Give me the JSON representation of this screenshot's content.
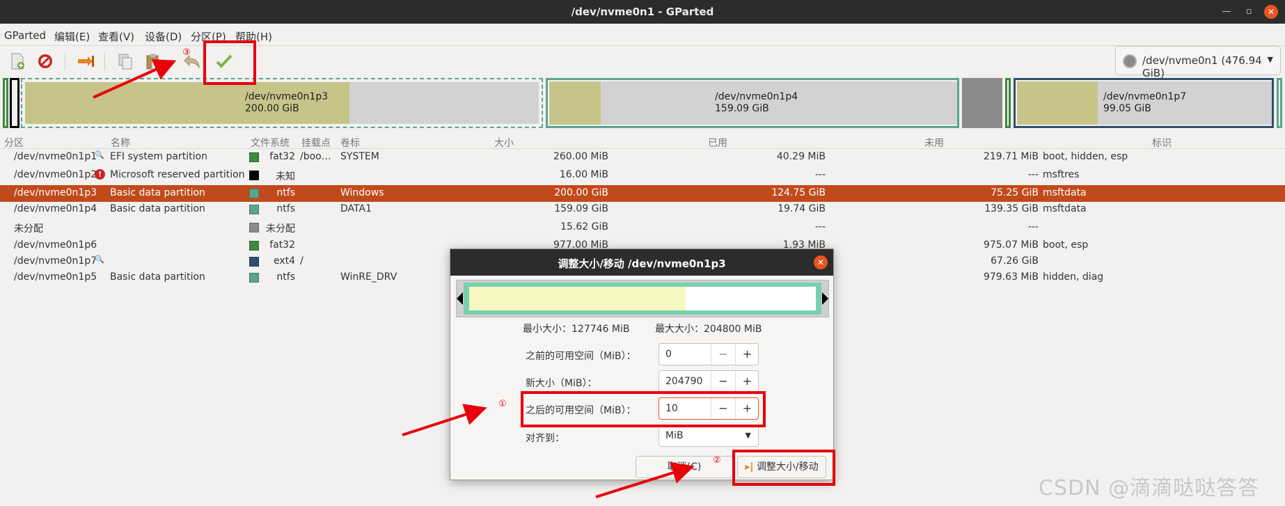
{
  "window": {
    "title": "/dev/nvme0n1 - GParted"
  },
  "menu": [
    "GParted",
    "编辑(E)",
    "查看(V)",
    "设备(D)",
    "分区(P)",
    "帮助(H)"
  ],
  "device_selector": {
    "label": "/dev/nvme0n1 (476.94 GiB)"
  },
  "partition_map": [
    {
      "name": "/dev/nvme0n1p3",
      "size": "200.00 GiB"
    },
    {
      "name": "/dev/nvme0n1p4",
      "size": "159.09 GiB"
    },
    {
      "name": "/dev/nvme0n1p7",
      "size": "99.05 GiB"
    }
  ],
  "table": {
    "headers": [
      "分区",
      "名称",
      "文件系统",
      "挂载点",
      "卷标",
      "大小",
      "已用",
      "未用",
      "标识"
    ],
    "rows": [
      {
        "partition": "/dev/nvme0n1p1",
        "name": "EFI system partition",
        "fs": "fat32",
        "fs_color": "#3c8a3c",
        "mount": "/boo…",
        "label": "SYSTEM",
        "size": "260.00 MiB",
        "used": "40.29 MiB",
        "unused": "219.71 MiB",
        "flags": "boot, hidden, esp",
        "icon": "key-icon"
      },
      {
        "partition": "/dev/nvme0n1p2",
        "name": "Microsoft reserved partition",
        "fs": "未知",
        "fs_color": "#000000",
        "mount": "",
        "label": "",
        "size": "16.00 MiB",
        "used": "---",
        "unused": "---",
        "flags": "msftres",
        "icon": "error-icon"
      },
      {
        "partition": "/dev/nvme0n1p3",
        "name": "Basic data partition",
        "fs": "ntfs",
        "fs_color": "#5aa58f",
        "mount": "",
        "label": "Windows",
        "size": "200.00 GiB",
        "used": "124.75 GiB",
        "unused": "75.25 GiB",
        "flags": "msftdata",
        "selected": true
      },
      {
        "partition": "/dev/nvme0n1p4",
        "name": "Basic data partition",
        "fs": "ntfs",
        "fs_color": "#5aa58f",
        "mount": "",
        "label": "DATA1",
        "size": "159.09 GiB",
        "used": "19.74 GiB",
        "unused": "139.35 GiB",
        "flags": "msftdata"
      },
      {
        "partition": "未分配",
        "name": "",
        "fs": "未分配",
        "fs_color": "#8a8a8a",
        "mount": "",
        "label": "",
        "size": "15.62 GiB",
        "used": "---",
        "unused": "---",
        "flags": ""
      },
      {
        "partition": "/dev/nvme0n1p6",
        "name": "",
        "fs": "fat32",
        "fs_color": "#3c8a3c",
        "mount": "",
        "label": "",
        "size": "977.00 MiB",
        "used": "1.93 MiB",
        "unused": "975.07 MiB",
        "flags": "boot, esp"
      },
      {
        "partition": "/dev/nvme0n1p7",
        "name": "",
        "fs": "ext4",
        "fs_color": "#314e6c",
        "mount": "/",
        "label": "",
        "size": "",
        "used": "",
        "unused": "67.26 GiB",
        "flags": "",
        "icon": "key-icon"
      },
      {
        "partition": "/dev/nvme0n1p5",
        "name": "Basic data partition",
        "fs": "ntfs",
        "fs_color": "#5aa58f",
        "mount": "",
        "label": "WinRE_DRV",
        "size": "",
        "used": "",
        "unused": "979.63 MiB",
        "flags": "hidden, diag"
      }
    ]
  },
  "dialog": {
    "title": "调整大小/移动 /dev/nvme0n1p3",
    "min_size": "最小大小：127746 MiB",
    "max_size": "最大大小：204800 MiB",
    "free_before_label": "之前的可用空间（MiB）：",
    "free_before_value": "0",
    "new_size_label": "新大小（MiB）：",
    "new_size_value": "204790",
    "free_after_label": "之后的可用空间（MiB）：",
    "free_after_value": "10",
    "align_label": "对齐到：",
    "align_value": "MiB",
    "cancel_label": "取消(C)",
    "resize_label": "调整大小/移动",
    "used_fraction": 0.625
  },
  "annotations": {
    "n1": "①",
    "n2": "②",
    "n3": "③"
  },
  "watermark": "CSDN @滴滴哒哒答答"
}
